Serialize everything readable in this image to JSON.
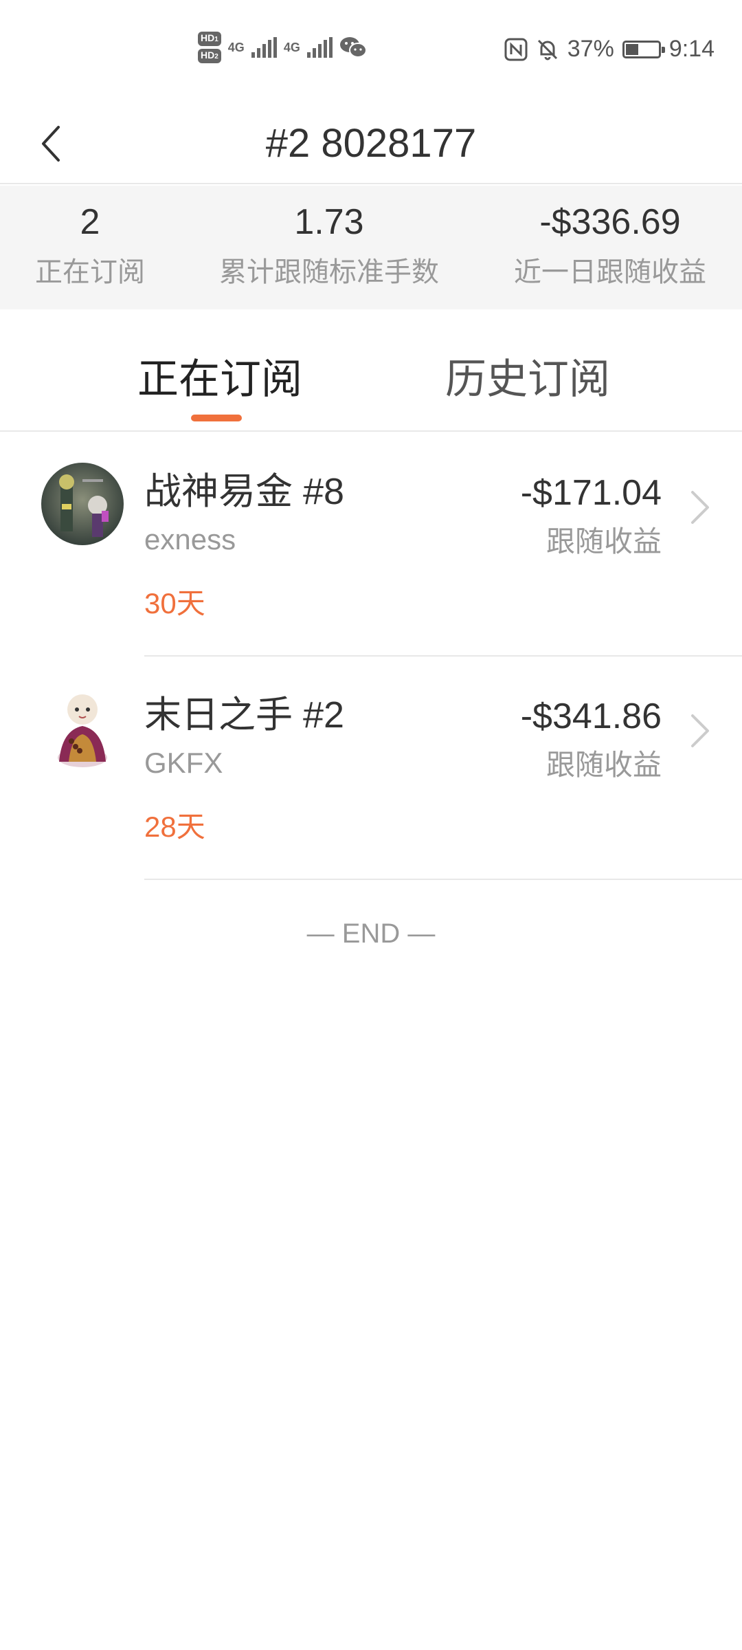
{
  "status_bar": {
    "sim1_badge": "HD",
    "sim1_num": "1",
    "sim2_badge": "HD",
    "sim2_num": "2",
    "net1": "4G",
    "net2": "4G",
    "battery_percent_text": "37%",
    "battery_level": 0.37,
    "time": "9:14",
    "icons": [
      "hd-icon",
      "signal-icon",
      "wechat-icon",
      "nfc-icon",
      "mute-icon",
      "battery-icon"
    ]
  },
  "header": {
    "title": "#2 8028177",
    "back_icon": "chevron-left-icon"
  },
  "stats": [
    {
      "value": "2",
      "label": "正在订阅"
    },
    {
      "value": "1.73",
      "label": "累计跟随标准手数"
    },
    {
      "value": "-$336.69",
      "label": "近一日跟随收益"
    }
  ],
  "tabs": [
    {
      "label": "正在订阅",
      "active": true
    },
    {
      "label": "历史订阅",
      "active": false
    }
  ],
  "subscriptions": [
    {
      "name": "战神易金 #8",
      "broker": "exness",
      "days": "30天",
      "amount": "-$171.04",
      "amount_label": "跟随收益"
    },
    {
      "name": "末日之手 #2",
      "broker": "GKFX",
      "days": "28天",
      "amount": "-$341.86",
      "amount_label": "跟随收益"
    }
  ],
  "end_text": "— END —",
  "colors": {
    "accent": "#f0703c",
    "primary_text": "#333333",
    "secondary_text": "#999999",
    "stats_background": "#f5f5f5"
  }
}
